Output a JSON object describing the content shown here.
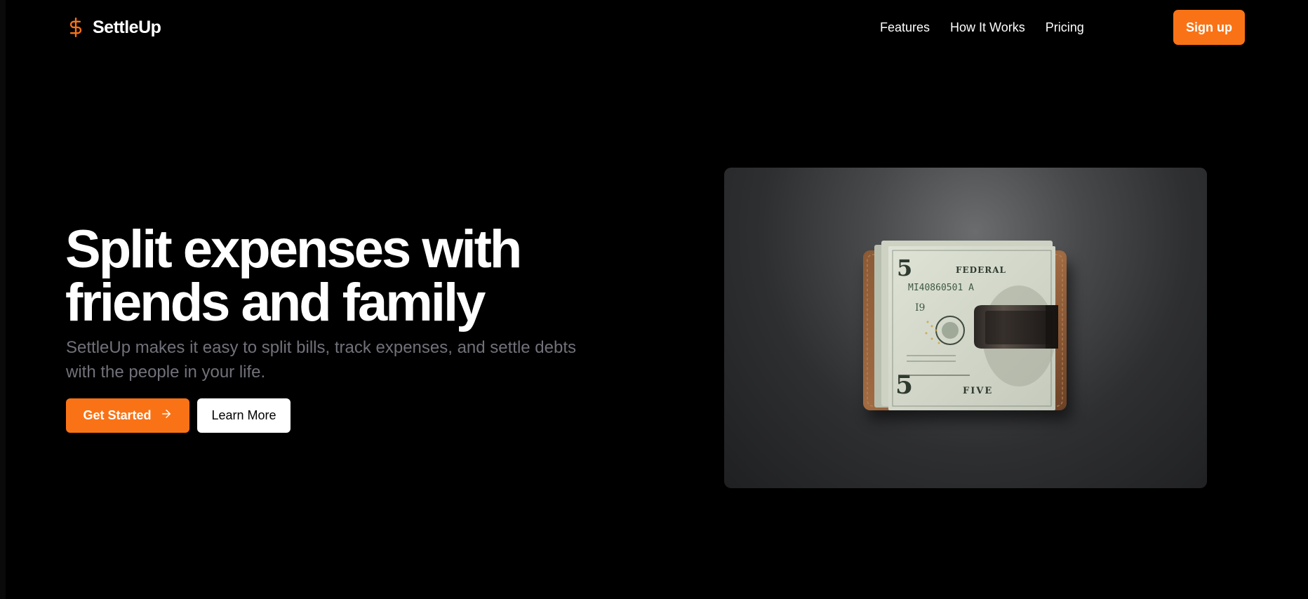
{
  "brand": {
    "name": "SettleUp",
    "icon": "dollar-icon",
    "accent": "#f97316"
  },
  "nav": {
    "links": [
      "Features",
      "How It Works",
      "Pricing"
    ],
    "signup_label": "Sign up"
  },
  "hero": {
    "title": "Split expenses with friends and family",
    "subtitle": "SettleUp makes it easy to split bills, track expenses, and settle debts with the people in your life.",
    "primary_cta": "Get Started",
    "primary_cta_icon": "arrow-right-icon",
    "secondary_cta": "Learn More"
  },
  "image": {
    "subject": "money-clip-icon",
    "bill": {
      "denomination": "5",
      "header": "FEDERAL",
      "serial": "MI 40860501 A",
      "district": "I9",
      "word": "FIVE"
    }
  }
}
